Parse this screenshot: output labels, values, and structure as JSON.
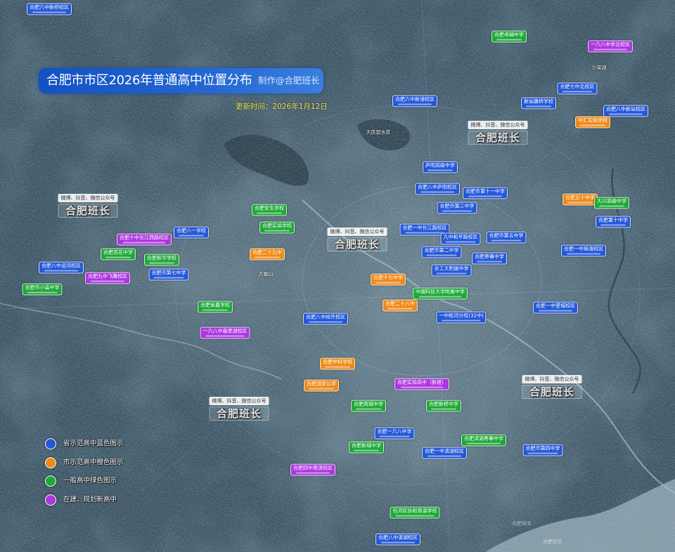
{
  "title": {
    "main": "合肥市市区2026年普通高中位置分布",
    "credit": "制作@合肥班长",
    "updated": "更新时间：2026年1月12日"
  },
  "watermark": {
    "line1": "微博、抖音、微信公众号",
    "line2": "合肥班长"
  },
  "legend": [
    {
      "label": "省示范高中蓝色图示",
      "color": "#2458d8"
    },
    {
      "label": "市示范高中橙色图示",
      "color": "#ee8a1a"
    },
    {
      "label": "一般高中绿色图示",
      "color": "#1fa83a"
    },
    {
      "label": "在建、规划新高中",
      "color": "#ab38de"
    }
  ],
  "schools": {
    "provincial": [
      "合肥六中新桥校区",
      "合肥六中新港校区",
      "合肥七中北校区",
      "新站康桥学校",
      "合肥八中新站校区",
      "庐阳高级中学",
      "合肥八中庐阳校区",
      "合肥市第十一中学",
      "合肥市第三中学",
      "合肥第十中学",
      "合肥八一学校",
      "合肥一中长江路校区",
      "九中和平路校区",
      "合肥市第五中学",
      "合肥市第二中学",
      "合肥寿春中学",
      "合肥一中瑶海校区",
      "合工大附属中学",
      "合肥八中运河校区",
      "合肥市第七中学",
      "合肥八中经开校区",
      "一中松河分校(32中)",
      "合肥一中望城校区",
      "合肥一六八中学",
      "合肥一中滨湖校区",
      "合肥市第四中学",
      "合肥八中滨湖校区"
    ],
    "municipal": [
      "中汇实验学校",
      "合肥五十中学",
      "合肥二十九中",
      "合肥十七中学",
      "合肥二十八中",
      "合肥中科学校",
      "合肥润安公学"
    ],
    "general": [
      "合肥卓越中学",
      "合肥安生学校",
      "合肥实验学校",
      "大兴高级中学",
      "合肥百花中学",
      "合肥新华学校",
      "合肥市小庙中学",
      "中国科技大学附属中学",
      "合肥金鑫学校",
      "合肥南城中学",
      "合肥新桥中学",
      "合肥新城中学",
      "合肥滨湖寿春中学",
      "包河区协和双语学校"
    ],
    "planned": [
      "一六八中学北校区",
      "合肥十中长江西路校区",
      "合肥九中飞鹰校区",
      "一六八中翡翠湖校区",
      "合肥实验高中（新建）",
      "合肥四中南滨校区"
    ]
  },
  "places": [
    "大房郢水库",
    "大蜀山",
    "少荃湖"
  ]
}
